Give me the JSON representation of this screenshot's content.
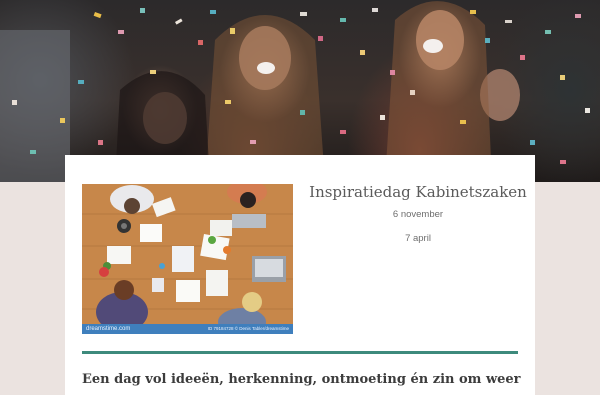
{
  "hero": {
    "image": "celebration-confetti-photo"
  },
  "event": {
    "title": "Inspiratiedag Kabinetszaken",
    "date_1": "6 november",
    "date_2": "7  april",
    "image": {
      "subject": "team-at-desk-photo",
      "brand": "dreamstime.com",
      "id": "ID 79184728 © Denis Tabler/dreamstime"
    }
  },
  "tagline": "Een dag vol ideeën, herkenning, ontmoeting én zin om weer",
  "colors": {
    "background": "#ebe3e0",
    "card": "#ffffff",
    "accent_rule": "#3d8a7c",
    "title": "#5b5b5b"
  }
}
